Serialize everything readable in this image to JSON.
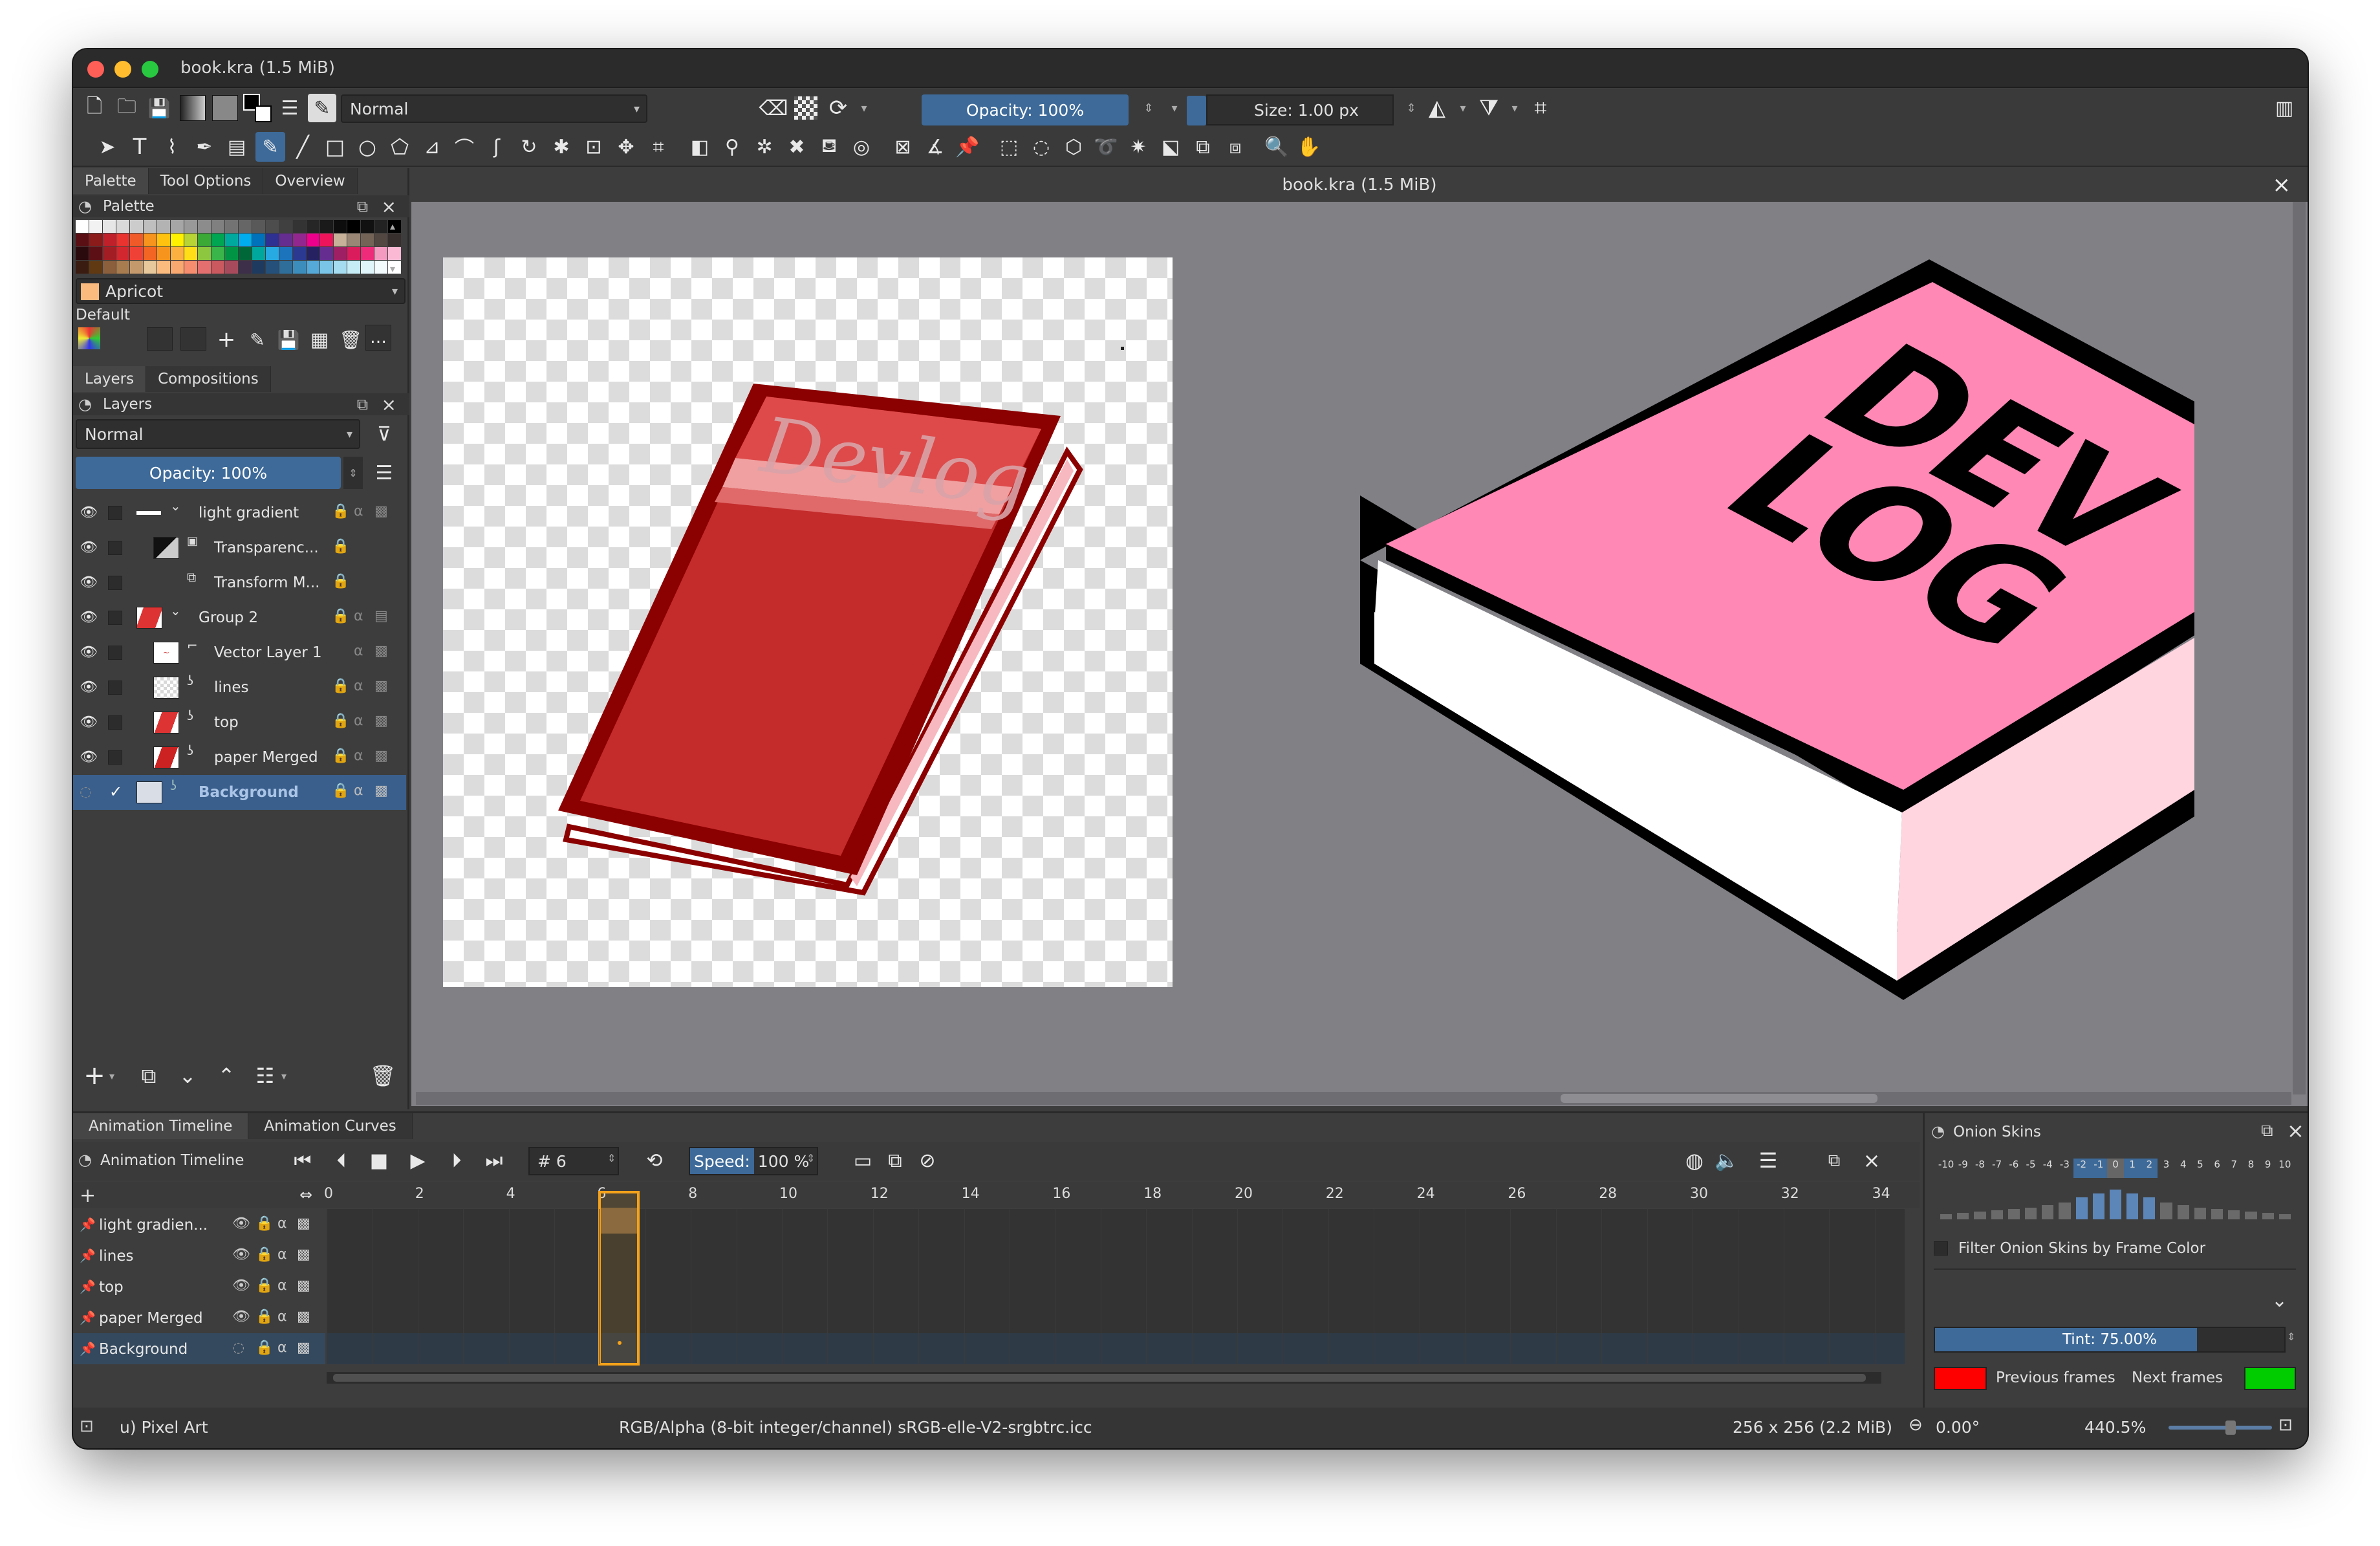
{
  "window": {
    "title": "book.kra (1.5 MiB)"
  },
  "toolbar": {
    "blend_mode": "Normal",
    "opacity": "Opacity: 100%",
    "size": "Size: 1.00 px"
  },
  "left_panel": {
    "tabs": [
      "Palette",
      "Tool Options",
      "Overview"
    ],
    "palette_title": "Palette",
    "color_name": "Apricot",
    "palette_name": "Default",
    "layer_tabs": [
      "Layers",
      "Compositions"
    ],
    "layers_title": "Layers",
    "layer_blend": "Normal",
    "layer_opacity": "Opacity: 100%",
    "layers": [
      {
        "name": "light gradient"
      },
      {
        "name": "Transparenc..."
      },
      {
        "name": "Transform M..."
      },
      {
        "name": "Group 2"
      },
      {
        "name": "Vector Layer 1"
      },
      {
        "name": "lines"
      },
      {
        "name": "top"
      },
      {
        "name": "paper Merged"
      },
      {
        "name": "Background"
      }
    ]
  },
  "canvas": {
    "title": "book.kra (1.5 MiB)",
    "pixel_text": "Devlog",
    "zoom_text_line1": "DEV",
    "zoom_text_line2": "LOG"
  },
  "animation": {
    "tabs": [
      "Animation Timeline",
      "Animation Curves"
    ],
    "title": "Animation Timeline",
    "frame": "# 6",
    "speed_label": "Speed:",
    "speed_value": "100 %",
    "ruler": [
      "0",
      "2",
      "4",
      "6",
      "8",
      "10",
      "12",
      "14",
      "16",
      "18",
      "20",
      "22",
      "24",
      "26",
      "28",
      "30",
      "32",
      "34"
    ],
    "tracks": [
      "light gradien...",
      "lines",
      "top",
      "paper Merged",
      "Background"
    ],
    "current_frame": 6
  },
  "onion": {
    "title": "Onion Skins",
    "scale": [
      "-10",
      "-9",
      "-8",
      "-7",
      "-6",
      "-5",
      "-4",
      "-3",
      "-2",
      "-1",
      "0",
      "1",
      "2",
      "3",
      "4",
      "5",
      "6",
      "7",
      "8",
      "9",
      "10"
    ],
    "filter_label": "Filter Onion Skins by Frame Color",
    "tint": "Tint: 75.00%",
    "tint_value": 75,
    "prev_label": "Previous frames",
    "next_label": "Next frames",
    "prev_color": "#ff0000",
    "next_color": "#00cc00"
  },
  "status": {
    "brush": "u) Pixel Art",
    "color_info": "RGB/Alpha (8-bit integer/channel)  sRGB-elle-V2-srgbtrc.icc",
    "image_size": "256 x 256 (2.2 MiB)",
    "rotation": "0.00°",
    "zoom": "440.5%"
  }
}
